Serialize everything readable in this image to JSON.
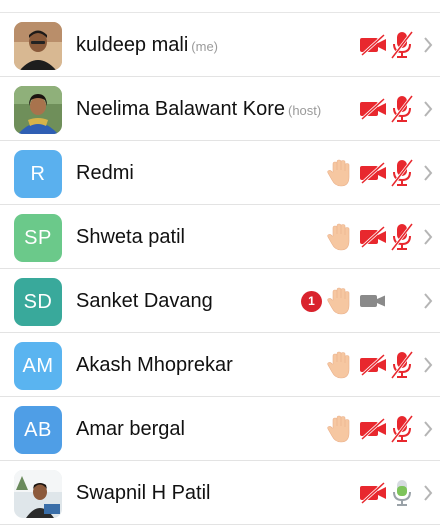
{
  "participants": [
    {
      "name": "kuldeep mali",
      "role": "(me)",
      "avatar_type": "photo",
      "photo": "man-portrait",
      "hand_raised": false,
      "video": "off",
      "mic": "muted"
    },
    {
      "name": "Neelima Balawant Kore",
      "role": "(host)",
      "avatar_type": "photo",
      "photo": "woman-portrait",
      "hand_raised": false,
      "video": "off",
      "mic": "muted"
    },
    {
      "name": "Redmi",
      "initials": "R",
      "avatar_color": "#5ab0ee",
      "hand_raised": true,
      "video": "off",
      "mic": "muted"
    },
    {
      "name": "Shweta patil",
      "initials": "SP",
      "avatar_color": "#6bc98a",
      "hand_raised": true,
      "video": "off",
      "mic": "muted"
    },
    {
      "name": "Sanket Davang",
      "initials": "SD",
      "avatar_color": "#39a99b",
      "hand_raised": true,
      "badge": "1",
      "video": "on",
      "mic": "none"
    },
    {
      "name": "Akash Mhoprekar",
      "initials": "AM",
      "avatar_color": "#5ab4f0",
      "hand_raised": true,
      "video": "off",
      "mic": "muted"
    },
    {
      "name": "Amar bergal",
      "initials": "AB",
      "avatar_color": "#4f9ee6",
      "hand_raised": true,
      "video": "off",
      "mic": "muted"
    },
    {
      "name": "Swapnil H Patil",
      "role": "",
      "avatar_type": "photo",
      "photo": "man-at-desk",
      "hand_raised": false,
      "video": "off",
      "mic": "active"
    }
  ],
  "icons": {
    "hand": "raised-hand-icon",
    "video_off": "video-off-icon",
    "video_on": "video-camera-icon",
    "mic_muted": "mic-muted-icon",
    "mic_active": "mic-active-icon",
    "chevron": "chevron-right-icon"
  },
  "colors": {
    "muted_red": "#e8282e",
    "hand_skin": "#f6c7a1",
    "mic_active_green": "#7dc35a",
    "video_gray": "#8a8a8a",
    "badge_red": "#d9232d"
  }
}
